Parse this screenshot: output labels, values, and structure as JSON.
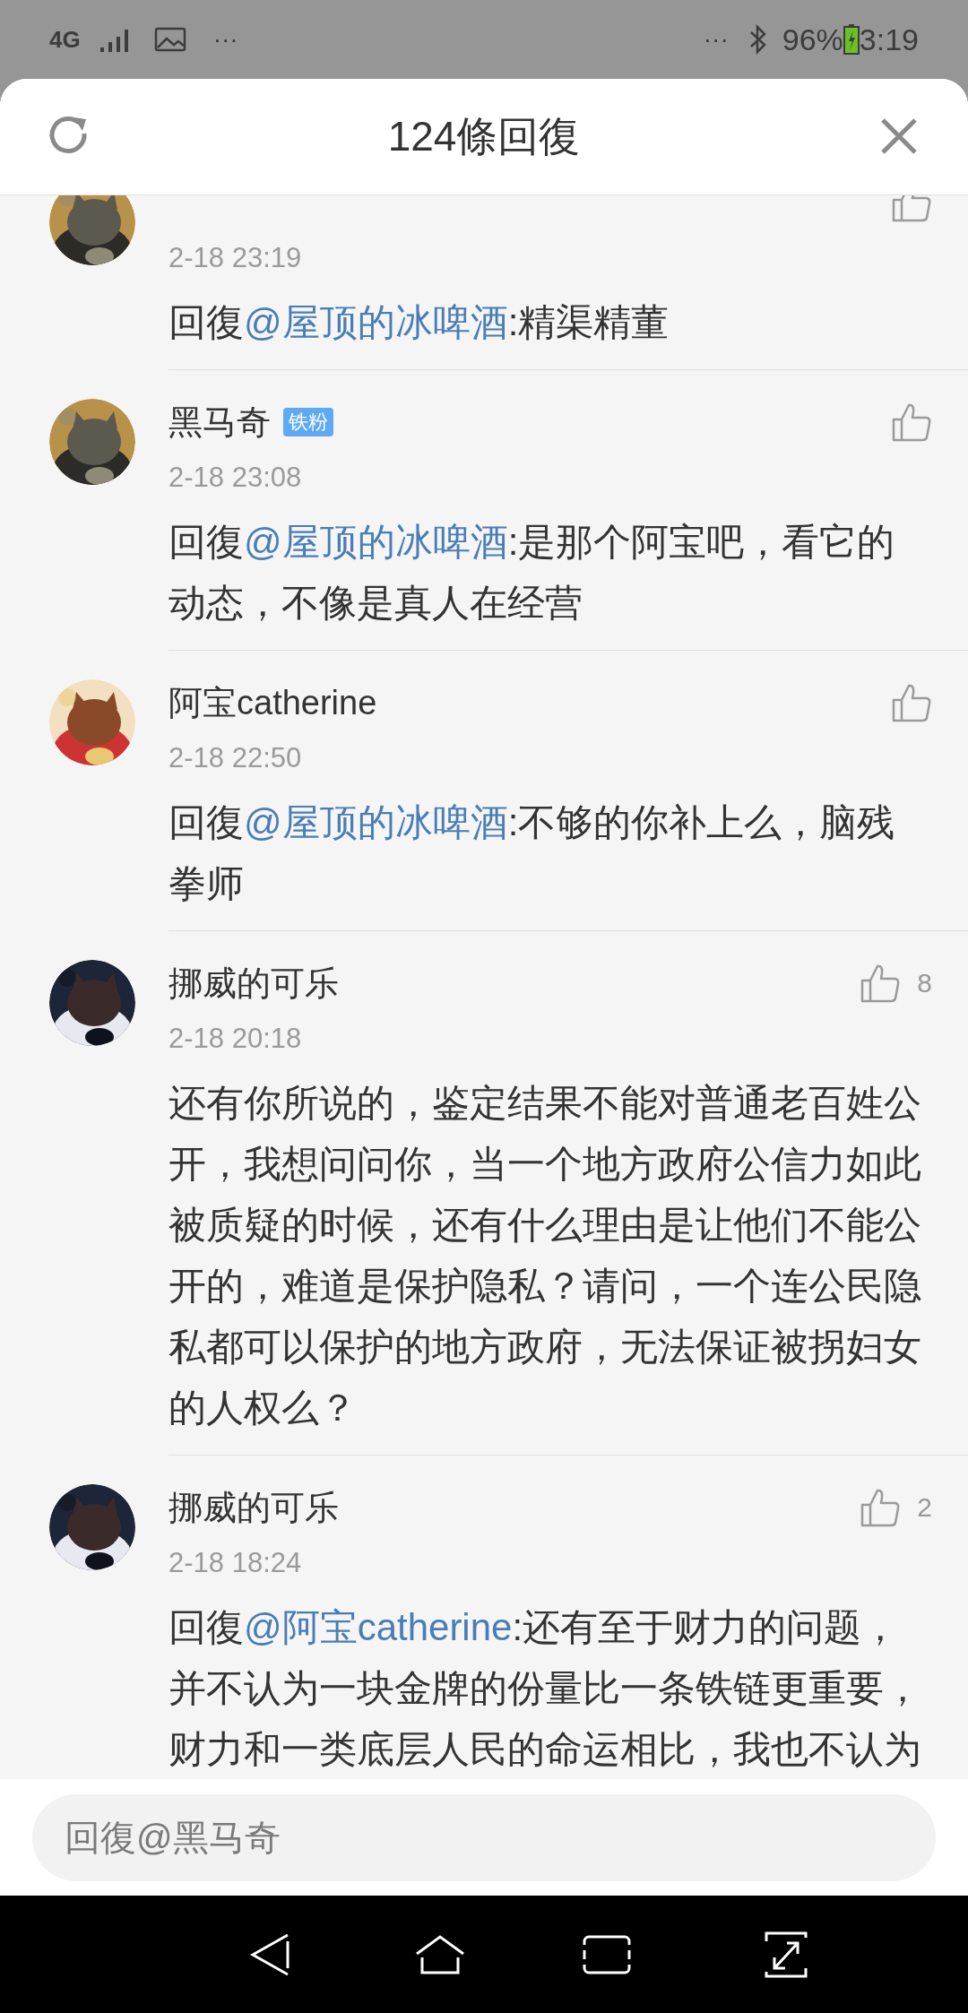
{
  "status_bar": {
    "network": "4G",
    "left_more": "···",
    "right_more": "···",
    "battery": "96%",
    "time": "3:19"
  },
  "header": {
    "title": "124條回復"
  },
  "comments": [
    {
      "time": "2-18 23:19",
      "prefix": "回復",
      "mention": "@屋顶的冰啤酒",
      "text": ":精渠精董"
    },
    {
      "name": "黑马奇",
      "badge": "铁粉",
      "time": "2-18 23:08",
      "prefix": "回復",
      "mention": "@屋顶的冰啤酒",
      "text": ":是那个阿宝吧，看它的动态，不像是真人在经营"
    },
    {
      "name": "阿宝catherine",
      "time": "2-18 22:50",
      "prefix": "回復",
      "mention": "@屋顶的冰啤酒",
      "text": ":不够的你补上么，脑残拳师"
    },
    {
      "name": "挪威的可乐",
      "time": "2-18 20:18",
      "likes": "8",
      "text": "还有你所说的，鉴定结果不能对普通老百姓公开，我想问问你，当一个地方政府公信力如此被质疑的时候，还有什么理由是让他们不能公开的，难道是保护隐私？请问，一个连公民隐私都可以保护的地方政府，无法保证被拐妇女的人权么？"
    },
    {
      "name": "挪威的可乐",
      "time": "2-18 18:24",
      "likes": "2",
      "prefix": "回復",
      "mention": "@阿宝catherine",
      "text": ":还有至于财力的问题，并不认为一块金牌的份量比一条铁链更重要，财力和一类底层人民的命运相比，我也不认为"
    }
  ],
  "reply_box": {
    "placeholder": "回復@黑马奇"
  }
}
